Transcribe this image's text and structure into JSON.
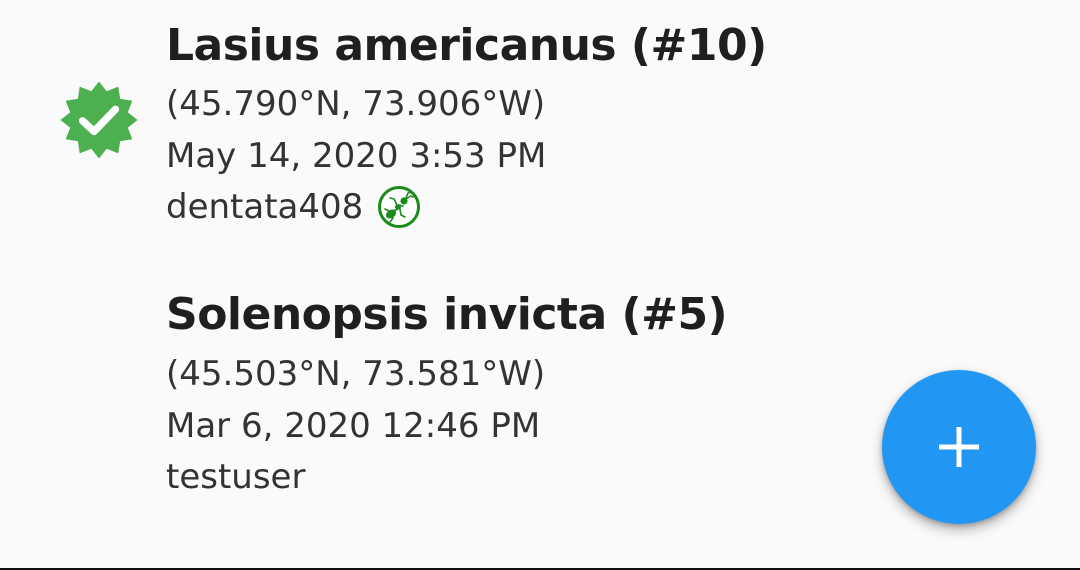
{
  "observations": [
    {
      "title": "Lasius americanus (#10)",
      "coordinates": "(45.790°N, 73.906°W)",
      "datetime": "May 14, 2020 3:53 PM",
      "username": "dentata408",
      "verified_icon": "verified-badge-icon",
      "user_icon": "ant-icon"
    },
    {
      "title": "Solenopsis invicta (#5)",
      "coordinates": "(45.503°N, 73.581°W)",
      "datetime": "Mar 6, 2020 12:46 PM",
      "username": "testuser"
    }
  ],
  "fab": {
    "icon": "plus-icon"
  },
  "colors": {
    "verified_green": "#4caf50",
    "ant_green": "#1b8a1b",
    "fab_blue": "#2196f3",
    "background": "#fafafa"
  }
}
